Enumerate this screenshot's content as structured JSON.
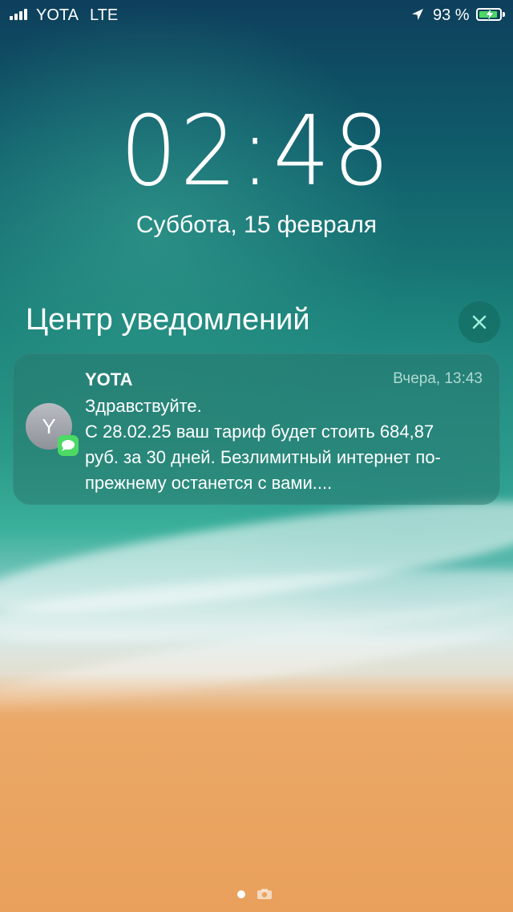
{
  "status_bar": {
    "carrier": "YOTA",
    "network": "LTE",
    "battery_percent": "93 %",
    "battery_level": 0.93,
    "icons": [
      "signal-bars-icon",
      "location-arrow-icon",
      "battery-charging-icon"
    ]
  },
  "lock_screen": {
    "time": "02:48",
    "date": "Суббота, 15 февраля"
  },
  "notification_center": {
    "title": "Центр уведомлений",
    "close_icon": "close-x-icon"
  },
  "notification": {
    "avatar_letter": "Y",
    "app_icon": "messages-bubble-icon",
    "sender": "YOTA",
    "time": "Вчера, 13:43",
    "lines": [
      "Здравствуйте.",
      "С 28.02.25 ваш тариф будет стоить 684,87",
      "руб. за 30 дней. Безлимитный интернет по-",
      "прежнему останется с вами...."
    ]
  },
  "pager": {
    "icons": [
      "page-dot-icon",
      "camera-icon"
    ]
  }
}
